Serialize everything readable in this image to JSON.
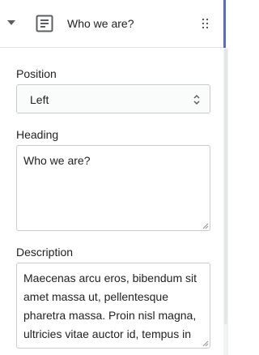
{
  "section": {
    "title": "Who we are?",
    "icon": "text-block-icon",
    "accent_color": "#5c6ac4"
  },
  "fields": {
    "position": {
      "label": "Position",
      "value": "Left"
    },
    "heading": {
      "label": "Heading",
      "value": "Who we are?"
    },
    "description": {
      "label": "Description",
      "value": "Maecenas arcu eros, bibendum sit amet massa ut, pellentesque pharetra massa. Proin nisl magna, ultricies vitae auctor id, tempus in"
    }
  }
}
